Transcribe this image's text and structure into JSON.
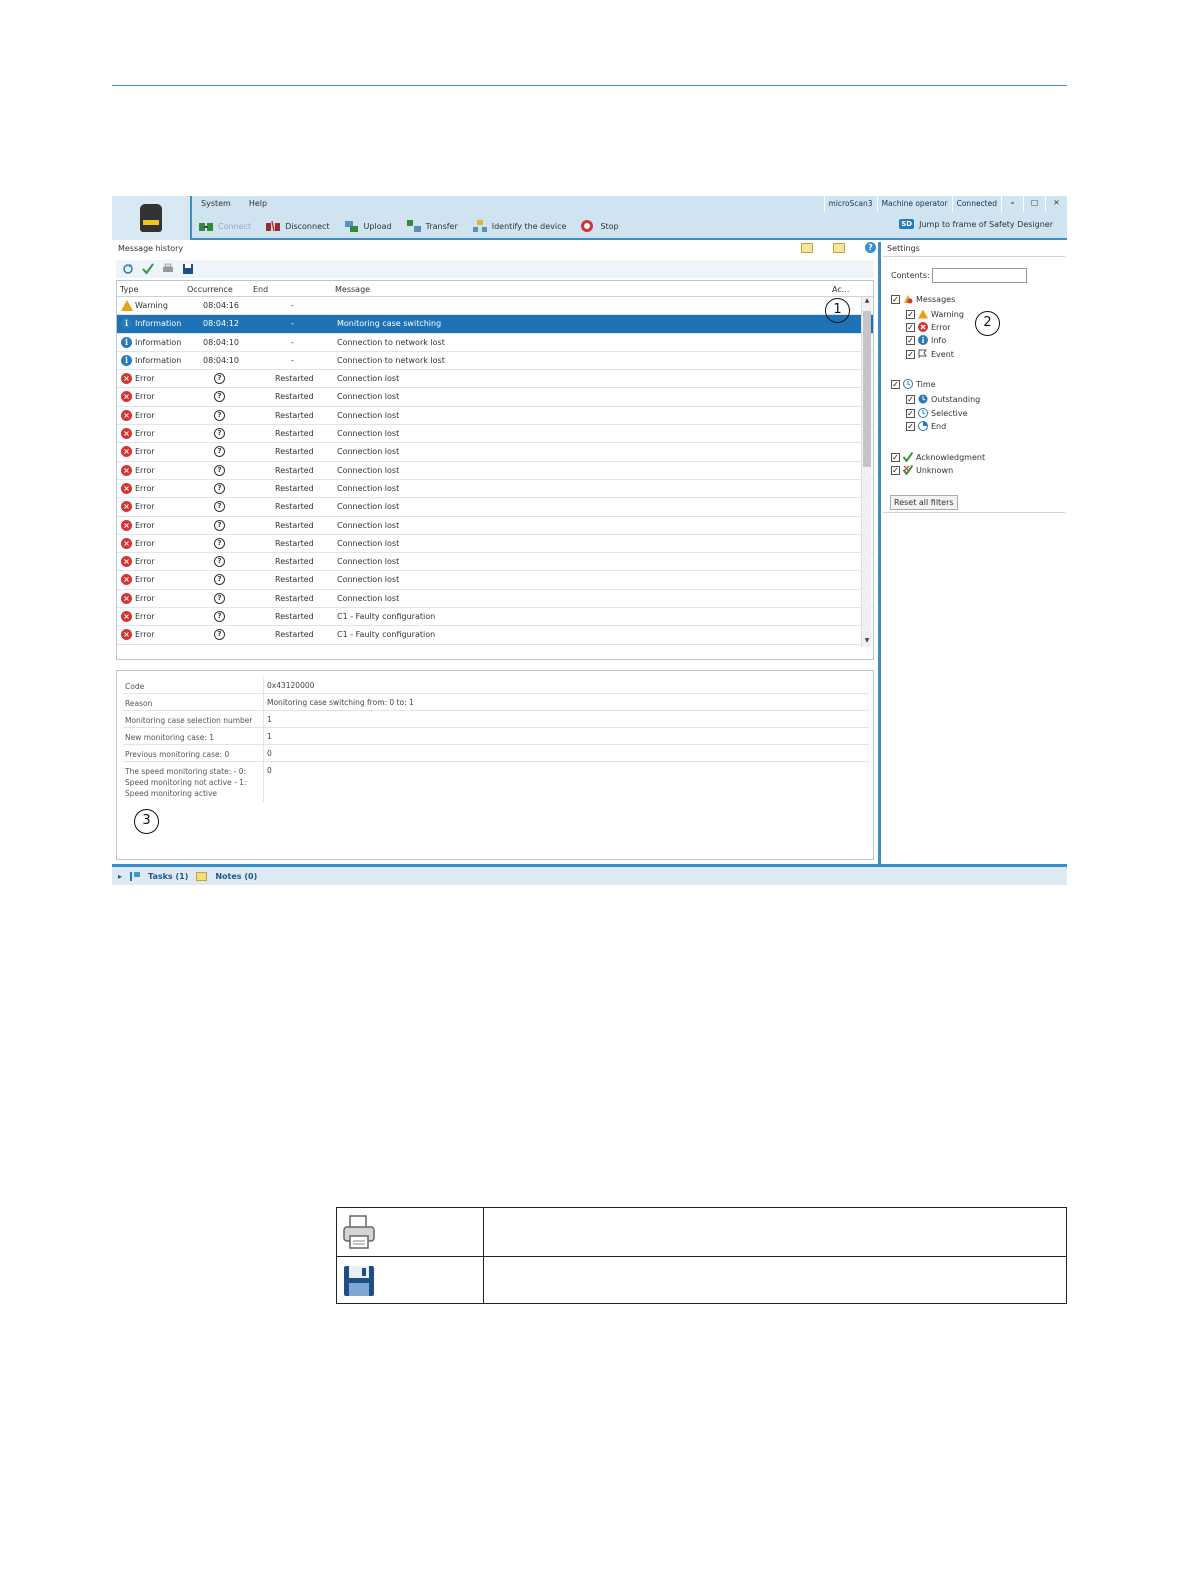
{
  "app": {
    "menu": [
      "System",
      "Help"
    ],
    "toolbar": {
      "connect": "Connect",
      "disconnect": "Disconnect",
      "upload": "Upload",
      "transfer": "Transfer",
      "identify": "Identify the device",
      "stop": "Stop"
    },
    "status": {
      "device": "microScan3",
      "role": "Machine operator",
      "connection": "Connected"
    },
    "jump": {
      "badge": "SD",
      "label": "Jump to frame of Safety Designer"
    }
  },
  "message_history": {
    "title": "Message history",
    "columns": {
      "type": "Type",
      "occurrence": "Occurrence",
      "end": "End",
      "message": "Message",
      "ack": "Ac..."
    },
    "rows": [
      {
        "icon": "warning-icon",
        "type": "Warning",
        "occurrence": "08:04:16",
        "end": "-",
        "message": ""
      },
      {
        "icon": "info-icon",
        "type": "Information",
        "occurrence": "08:04:12",
        "end": "-",
        "message": "Monitoring case switching",
        "selected": true
      },
      {
        "icon": "info-icon",
        "type": "Information",
        "occurrence": "08:04:10",
        "end": "-",
        "message": "Connection to network lost"
      },
      {
        "icon": "info-icon",
        "type": "Information",
        "occurrence": "08:04:10",
        "end": "-",
        "message": "Connection to network lost"
      },
      {
        "icon": "error-icon",
        "type": "Error",
        "occurrence": "?",
        "end": "Restarted",
        "message": "Connection lost"
      },
      {
        "icon": "error-icon",
        "type": "Error",
        "occurrence": "?",
        "end": "Restarted",
        "message": "Connection lost"
      },
      {
        "icon": "error-icon",
        "type": "Error",
        "occurrence": "?",
        "end": "Restarted",
        "message": "Connection lost"
      },
      {
        "icon": "error-icon",
        "type": "Error",
        "occurrence": "?",
        "end": "Restarted",
        "message": "Connection lost"
      },
      {
        "icon": "error-icon",
        "type": "Error",
        "occurrence": "?",
        "end": "Restarted",
        "message": "Connection lost"
      },
      {
        "icon": "error-icon",
        "type": "Error",
        "occurrence": "?",
        "end": "Restarted",
        "message": "Connection lost"
      },
      {
        "icon": "error-icon",
        "type": "Error",
        "occurrence": "?",
        "end": "Restarted",
        "message": "Connection lost"
      },
      {
        "icon": "error-icon",
        "type": "Error",
        "occurrence": "?",
        "end": "Restarted",
        "message": "Connection lost"
      },
      {
        "icon": "error-icon",
        "type": "Error",
        "occurrence": "?",
        "end": "Restarted",
        "message": "Connection lost"
      },
      {
        "icon": "error-icon",
        "type": "Error",
        "occurrence": "?",
        "end": "Restarted",
        "message": "Connection lost"
      },
      {
        "icon": "error-icon",
        "type": "Error",
        "occurrence": "?",
        "end": "Restarted",
        "message": "Connection lost"
      },
      {
        "icon": "error-icon",
        "type": "Error",
        "occurrence": "?",
        "end": "Restarted",
        "message": "Connection lost"
      },
      {
        "icon": "error-icon",
        "type": "Error",
        "occurrence": "?",
        "end": "Restarted",
        "message": "Connection lost"
      },
      {
        "icon": "error-icon",
        "type": "Error",
        "occurrence": "?",
        "end": "Restarted",
        "message": "C1 - Faulty configuration"
      },
      {
        "icon": "error-icon",
        "type": "Error",
        "occurrence": "?",
        "end": "Restarted",
        "message": "C1 - Faulty configuration"
      }
    ]
  },
  "details": [
    {
      "key": "Code",
      "value": "0x43120000"
    },
    {
      "key": "Reason",
      "value": "Monitoring case switching from: 0 to: 1"
    },
    {
      "key": "Monitoring case selection number",
      "value": "1"
    },
    {
      "key": "New monitoring case: 1",
      "value": "1"
    },
    {
      "key": "Previous monitoring case: 0",
      "value": "0"
    },
    {
      "key": "The speed monitoring state: - 0: Speed monitoring not active - 1: Speed monitoring active",
      "value": "0"
    }
  ],
  "settings": {
    "title": "Settings",
    "contents_label": "Contents:",
    "contents_value": "",
    "messages": "Messages",
    "warning": "Warning",
    "error": "Error",
    "info": "Info",
    "event": "Event",
    "time": "Time",
    "outstanding": "Outstanding",
    "selective": "Selective",
    "end": "End",
    "acknowledgment": "Acknowledgment",
    "unknown": "Unknown",
    "reset": "Reset all filters"
  },
  "callouts": [
    "1",
    "2",
    "3"
  ],
  "bottombar": {
    "tasks": "Tasks (1)",
    "notes": "Notes (0)"
  },
  "colors": {
    "accent": "#3b8ec8",
    "selection": "#1e73b6",
    "error": "#d63333",
    "warning": "#e8a21a"
  }
}
